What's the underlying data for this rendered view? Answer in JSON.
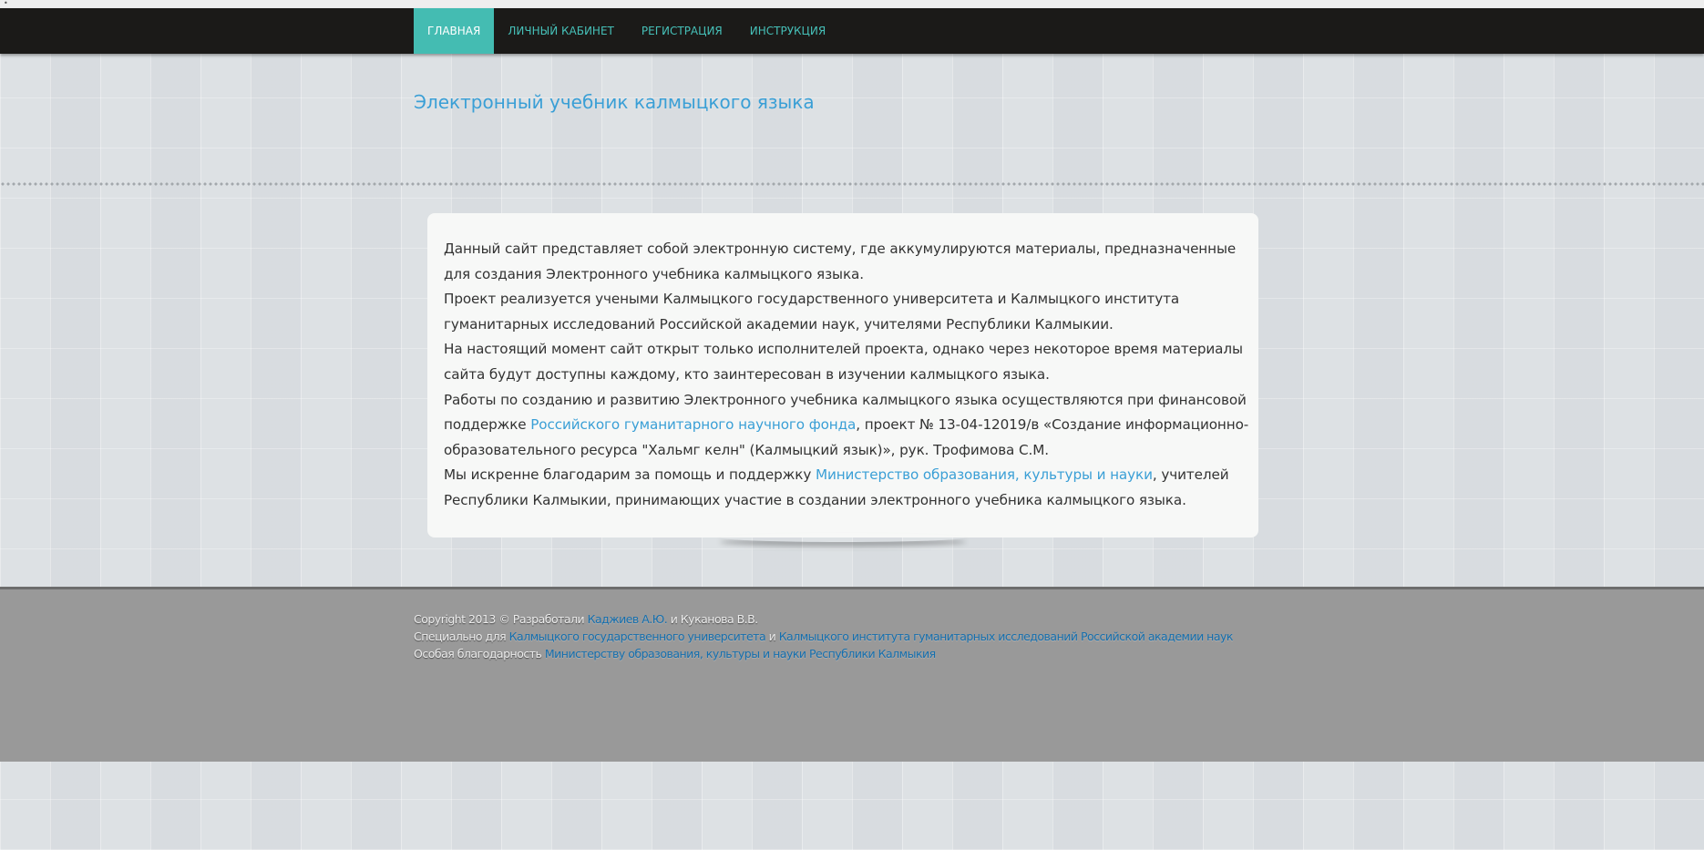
{
  "nav": {
    "items": [
      {
        "label": "ГЛАВНАЯ"
      },
      {
        "label": "ЛИЧНЫЙ КАБИНЕТ"
      },
      {
        "label": "РЕГИСТРАЦИЯ"
      },
      {
        "label": "ИНСТРУКЦИЯ"
      }
    ]
  },
  "header": {
    "title": "Электронный учебник калмыцкого языка"
  },
  "main": {
    "p1": "Данный сайт представляет собой электронную систему, где аккумулируются материалы, предназначенные для создания Электронного учебника калмыцкого языка.",
    "p2": "Проект реализуется учеными Калмыцкого государственного университета и Калмыцкого института гуманитарных исследований Российской академии наук, учителями Республики Калмыкии.",
    "p3": "На настоящий момент сайт открыт только исполнителей проекта, однако через некоторое время материалы сайта будут доступны каждому, кто заинтересован в изучении калмыцкого языка.",
    "p4_before": "Работы по созданию и развитию Электронного учебника калмыцкого языка осуществляются при финансовой поддержке ",
    "p4_link": "Российского гуманитарного научного фонда",
    "p4_after": ", проект № 13-04-12019/в «Создание информационно-образовательного ресурса \"Хальмг келн\" (Калмыцкий язык)», рук. Трофимова С.М.",
    "p5_before": "Мы искренне благодарим за помощь и поддержку ",
    "p5_link": "Министерство образования, культуры и науки",
    "p5_after": ", учителей Республики Калмыкии, принимающих участие в создании электронного учебника калмыцкого языка."
  },
  "footer": {
    "line1_before": "Copyright 2013 © Разработали ",
    "line1_link": "Каджиев А.Ю.",
    "line1_after": " и Куканова В.В.",
    "line2_before": "Специально для ",
    "line2_link1": "Калмыцкого государственного университета",
    "line2_mid": " и ",
    "line2_link2": "Калмыцкого института гуманитарных исследований Российской академии наук",
    "line3_before": "Особая благодарность ",
    "line3_link": "Министерству образования, культуры и науки Республики Калмыкия"
  },
  "colors": {
    "navbar": "#1b1a18",
    "nav_active": "#44bcb2",
    "nav_link": "#46c0b8",
    "link": "#3a9fd6",
    "footer": "#999999"
  }
}
